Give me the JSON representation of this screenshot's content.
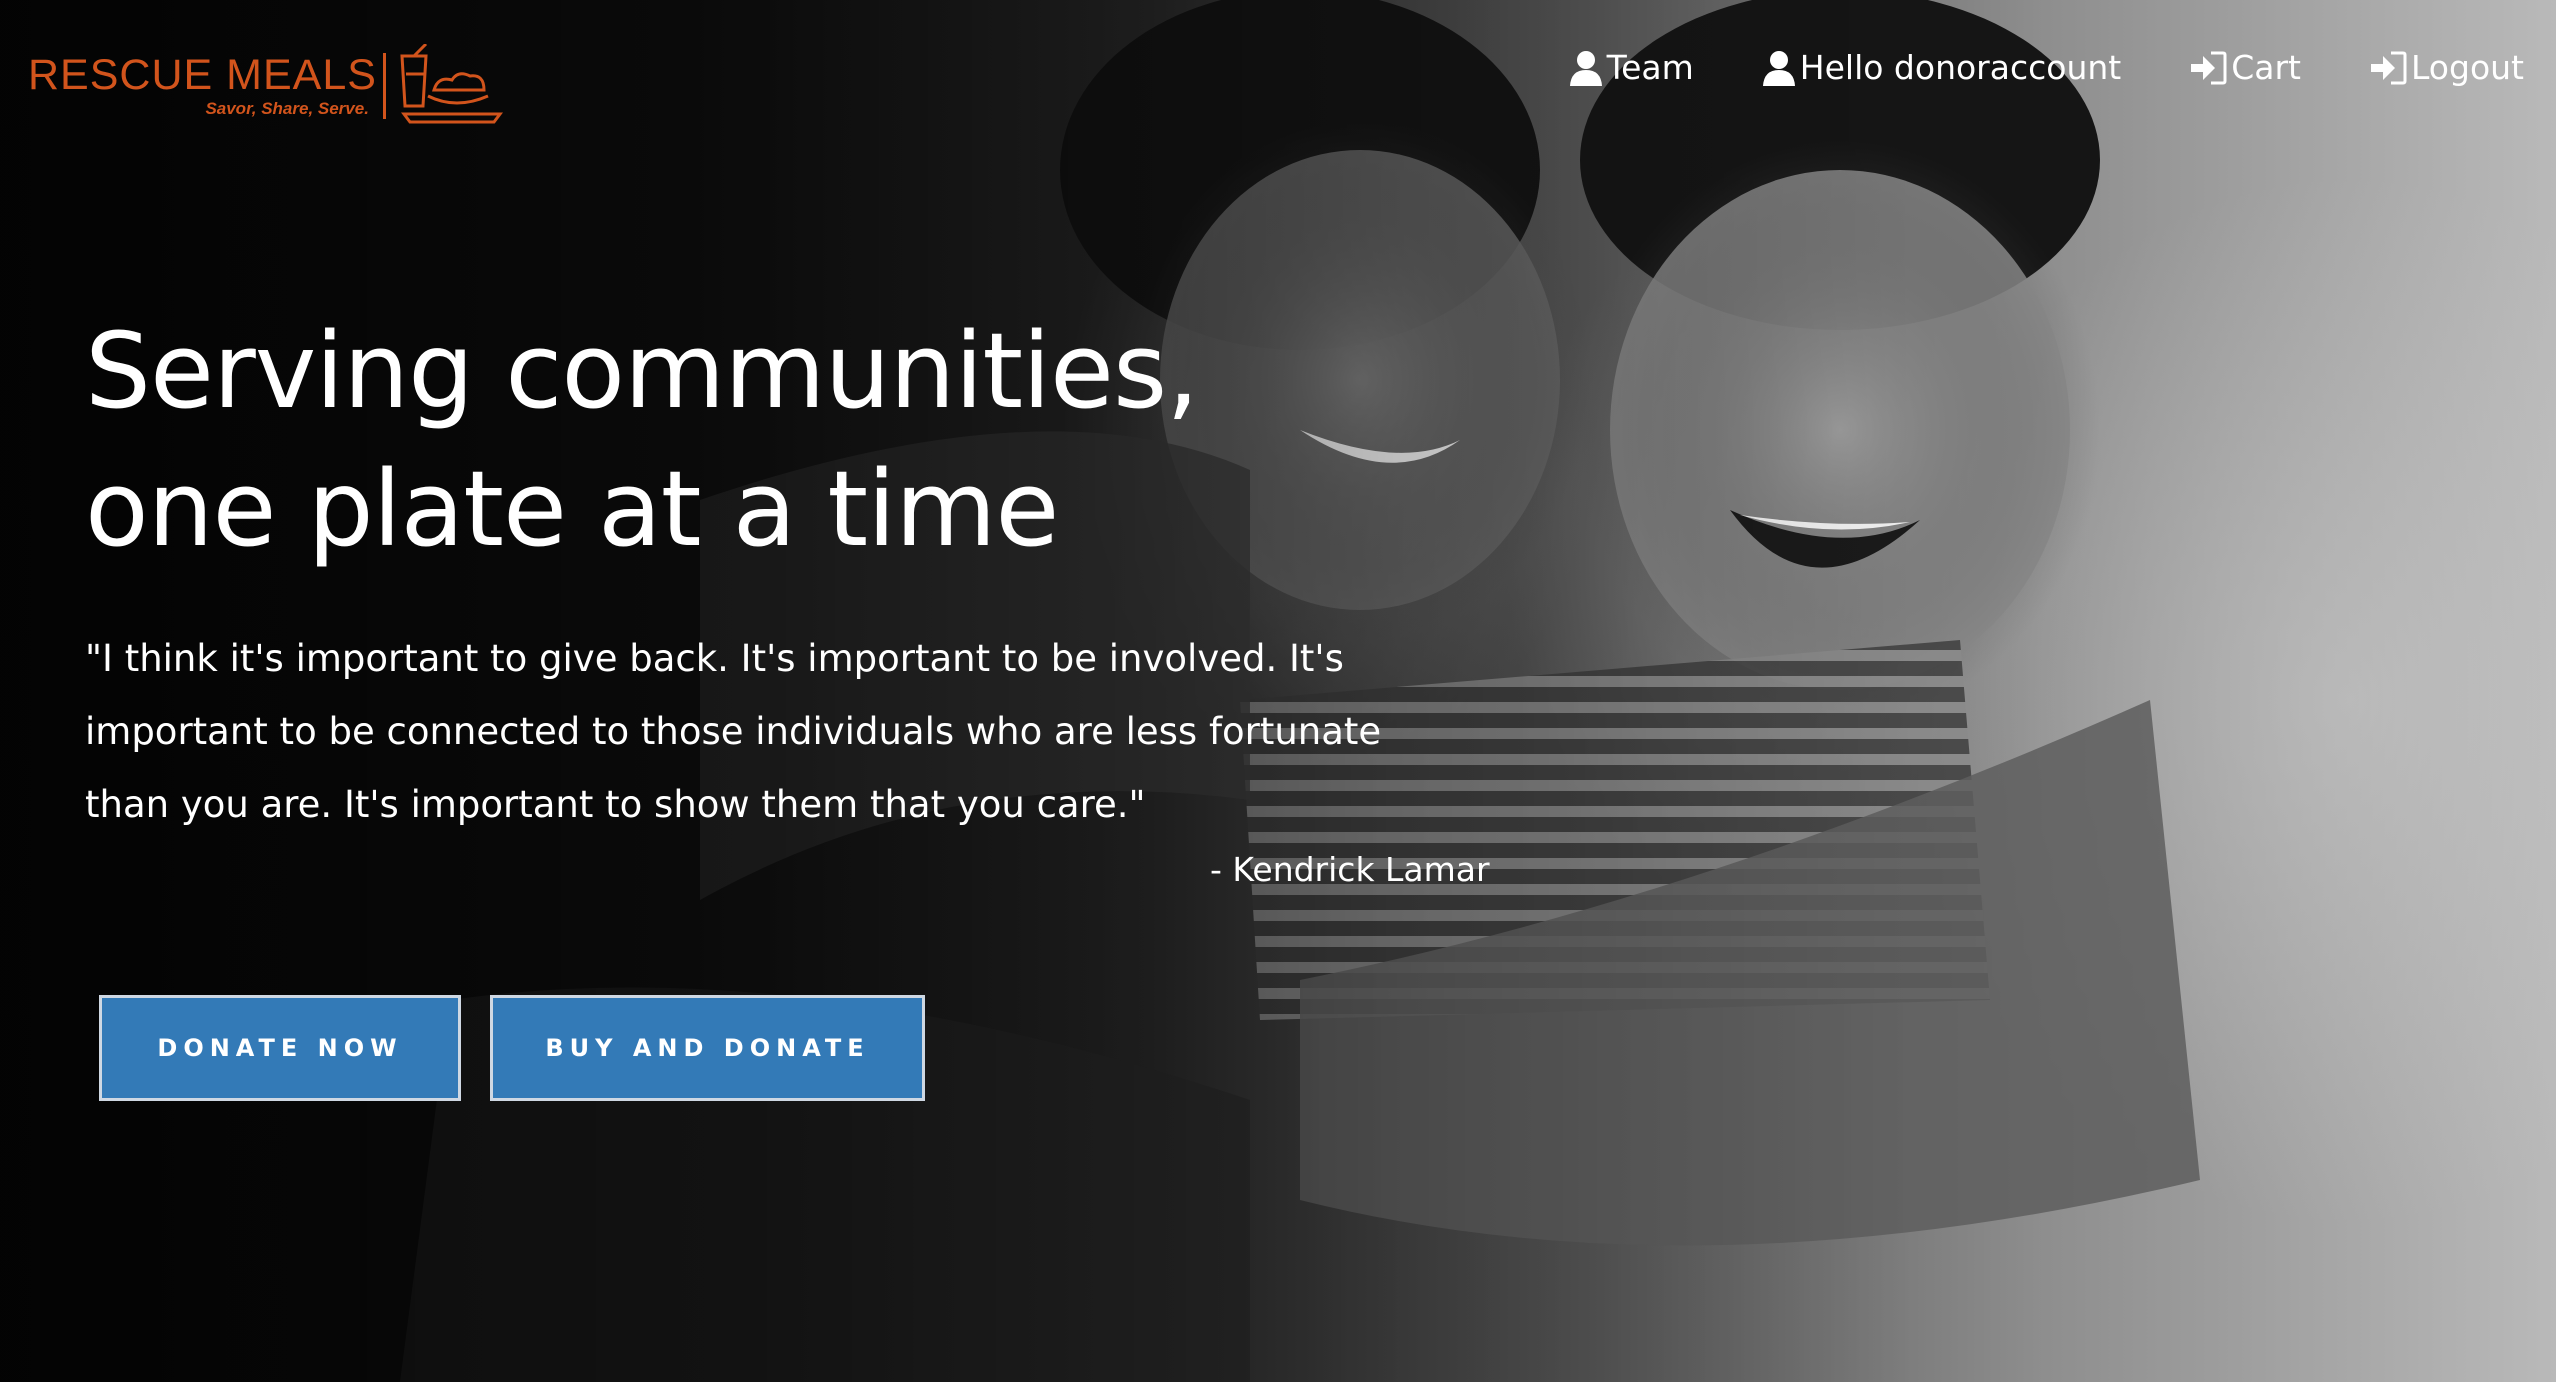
{
  "brand": {
    "name": "RESCUE MEALS",
    "tagline": "Savor, Share, Serve.",
    "color": "#d2541c"
  },
  "nav": {
    "items": [
      {
        "label": "Team",
        "icon": "user-icon"
      },
      {
        "label": "Hello donoraccount",
        "icon": "user-icon"
      },
      {
        "label": "Cart",
        "icon": "sign-in-icon"
      },
      {
        "label": "Logout",
        "icon": "sign-in-icon"
      }
    ]
  },
  "hero": {
    "headline_line1": "Serving communities,",
    "headline_line2": "one plate at a time",
    "quote_line1": "\"I think it's important to give back. It's important to be involved. It's",
    "quote_line2": "important to be connected to those individuals who are less fortunate",
    "quote_line3": "than you are. It's important to show them that you care.\"",
    "quote_author": "- Kendrick Lamar",
    "background": "black-and-white photo of two smiling boys hugging"
  },
  "buttons": {
    "donate_label": "DONATE NOW",
    "buy_label": "BUY AND DONATE",
    "color": "#337ab7"
  }
}
